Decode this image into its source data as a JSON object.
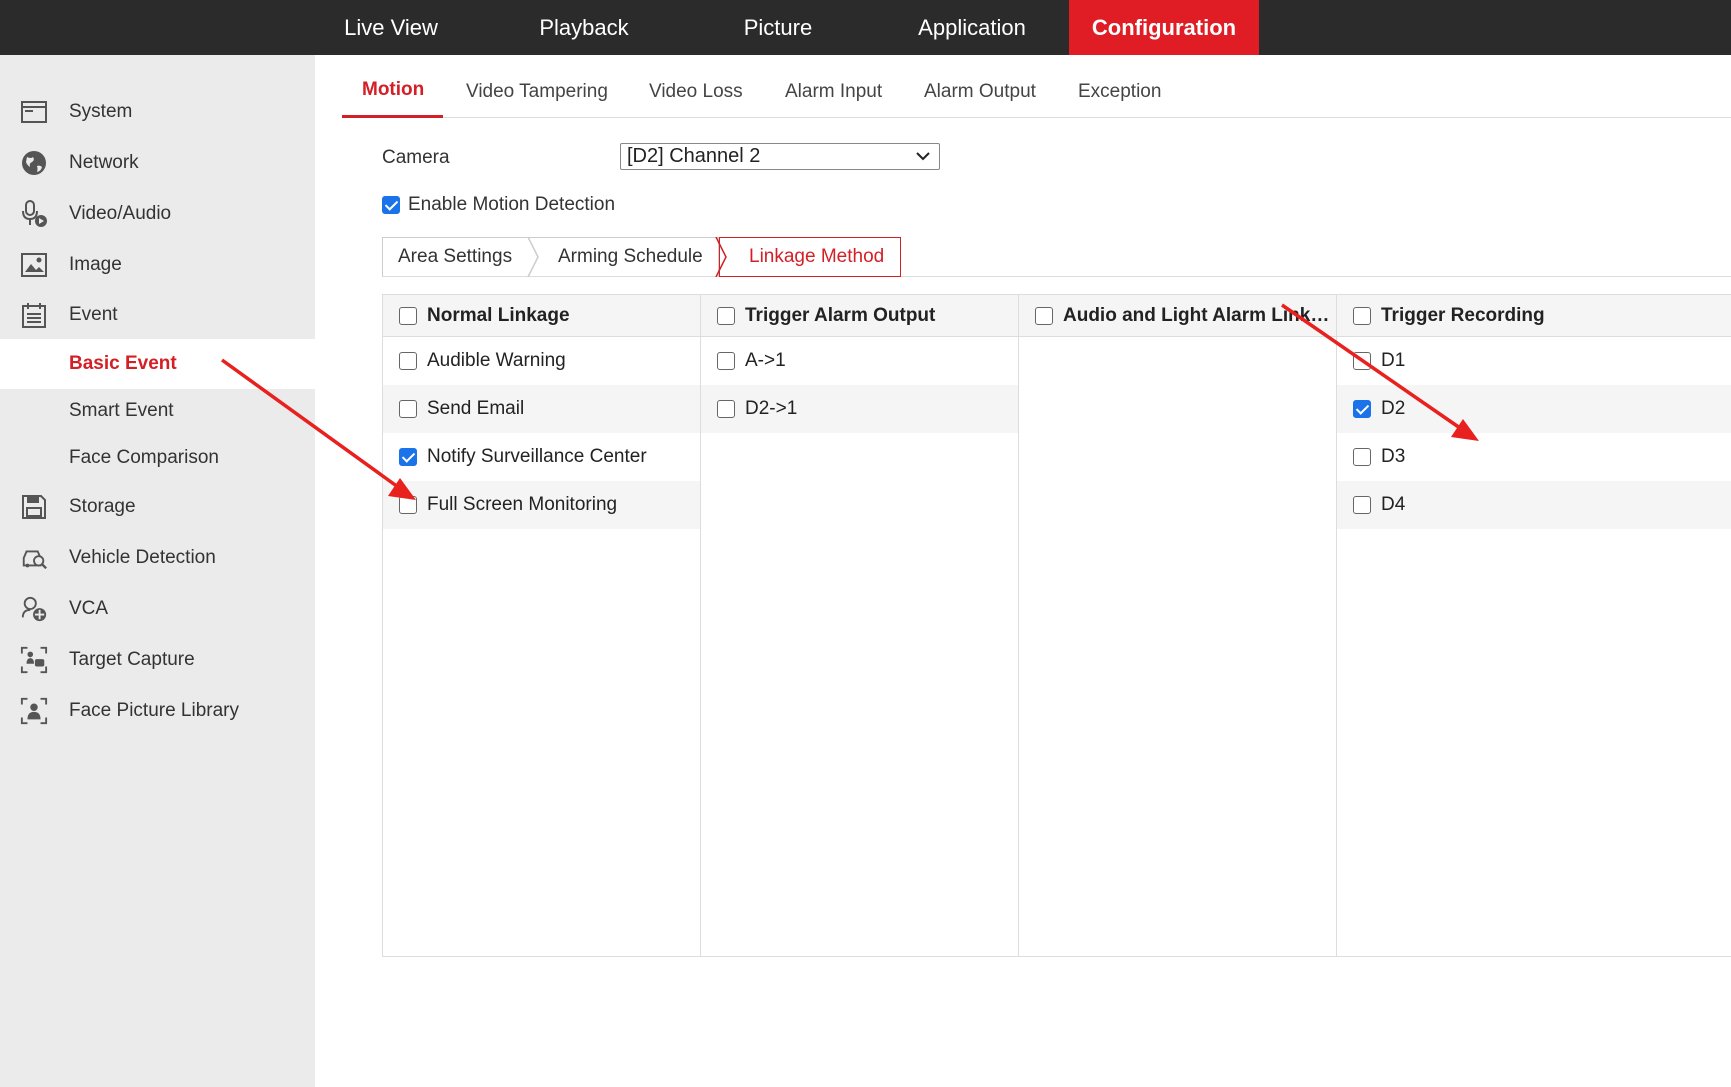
{
  "topnav": {
    "items": [
      {
        "label": "Live View",
        "active": false
      },
      {
        "label": "Playback",
        "active": false
      },
      {
        "label": "Picture",
        "active": false
      },
      {
        "label": "Application",
        "active": false
      },
      {
        "label": "Configuration",
        "active": true
      }
    ]
  },
  "sidebar": {
    "items": [
      {
        "label": "System",
        "icon": "system-icon"
      },
      {
        "label": "Network",
        "icon": "globe-icon"
      },
      {
        "label": "Video/Audio",
        "icon": "microphone-icon"
      },
      {
        "label": "Image",
        "icon": "image-icon"
      },
      {
        "label": "Event",
        "icon": "calendar-icon"
      },
      {
        "label": "Basic Event",
        "sub": true,
        "active": true
      },
      {
        "label": "Smart Event",
        "sub": true
      },
      {
        "label": "Face Comparison",
        "sub": true
      },
      {
        "label": "Storage",
        "icon": "floppy-icon"
      },
      {
        "label": "Vehicle Detection",
        "icon": "car-search-icon"
      },
      {
        "label": "VCA",
        "icon": "vca-icon"
      },
      {
        "label": "Target Capture",
        "icon": "target-capture-icon"
      },
      {
        "label": "Face Picture Library",
        "icon": "face-library-icon"
      }
    ]
  },
  "tabs": [
    "Motion",
    "Video Tampering",
    "Video Loss",
    "Alarm Input",
    "Alarm Output",
    "Exception"
  ],
  "camera": {
    "label": "Camera",
    "value": "[D2] Channel 2"
  },
  "enable_motion": {
    "label": "Enable Motion Detection",
    "checked": true
  },
  "subtabs": [
    "Area Settings",
    "Arming Schedule",
    "Linkage Method"
  ],
  "linkage": {
    "columns": [
      {
        "header": "Normal Linkage",
        "checked": false,
        "items": [
          {
            "label": "Audible Warning",
            "checked": false
          },
          {
            "label": "Send Email",
            "checked": false
          },
          {
            "label": "Notify Surveillance Center",
            "checked": true
          },
          {
            "label": "Full Screen Monitoring",
            "checked": false
          }
        ]
      },
      {
        "header": "Trigger Alarm Output",
        "checked": false,
        "items": [
          {
            "label": "A->1",
            "checked": false
          },
          {
            "label": "D2->1",
            "checked": false
          }
        ]
      },
      {
        "header": "Audio and Light Alarm Link…",
        "checked": false,
        "items": []
      },
      {
        "header": "Trigger Recording",
        "checked": false,
        "items": [
          {
            "label": "D1",
            "checked": false
          },
          {
            "label": "D2",
            "checked": true
          },
          {
            "label": "D3",
            "checked": false
          },
          {
            "label": "D4",
            "checked": false
          }
        ]
      }
    ]
  },
  "colors": {
    "accent": "#e01c24",
    "active_text": "#d32027",
    "checkbox": "#1a73e8",
    "annotation_arrow": "#e8201e"
  }
}
